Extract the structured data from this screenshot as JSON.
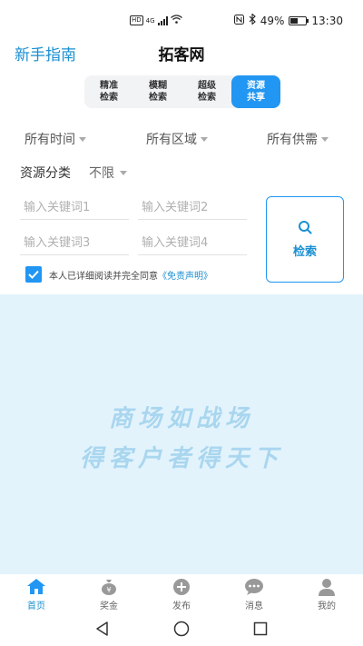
{
  "status_bar": {
    "hd": "HD",
    "network": "4G",
    "battery_text": "49%",
    "battery_level": 0.49,
    "time": "13:30"
  },
  "header": {
    "guide_label": "新手指南",
    "title": "拓客网"
  },
  "mode_tabs": [
    {
      "label": "精准\n检索",
      "active": false
    },
    {
      "label": "模糊\n检索",
      "active": false
    },
    {
      "label": "超级\n检索",
      "active": false
    },
    {
      "label": "资源\n共享",
      "active": true
    }
  ],
  "filters": {
    "time": "所有时间",
    "region": "所有区域",
    "supply": "所有供需"
  },
  "category": {
    "label": "资源分类",
    "value": "不限"
  },
  "keywords": {
    "kw1_placeholder": "输入关键词1",
    "kw2_placeholder": "输入关键词2",
    "kw3_placeholder": "输入关键词3",
    "kw4_placeholder": "输入关键词4"
  },
  "search_button": {
    "label": "检索",
    "icon": "search-icon"
  },
  "agreement": {
    "checked": true,
    "text": "本人已详细阅读并完全同意",
    "link": "《免责声明》"
  },
  "banner": {
    "line1": "商场如战场",
    "line2": "得客户者得天下"
  },
  "bottom_nav": [
    {
      "label": "首页",
      "icon": "home-icon",
      "active": true
    },
    {
      "label": "奖金",
      "icon": "money-bag-icon",
      "active": false
    },
    {
      "label": "发布",
      "icon": "plus-circle-icon",
      "active": false
    },
    {
      "label": "消息",
      "icon": "chat-icon",
      "active": false
    },
    {
      "label": "我的",
      "icon": "person-icon",
      "active": false
    }
  ],
  "colors": {
    "accent": "#2196f3",
    "link": "#1a8fd1",
    "banner_bg": "#e3f3fc",
    "slogan": "#a9d6ef"
  }
}
